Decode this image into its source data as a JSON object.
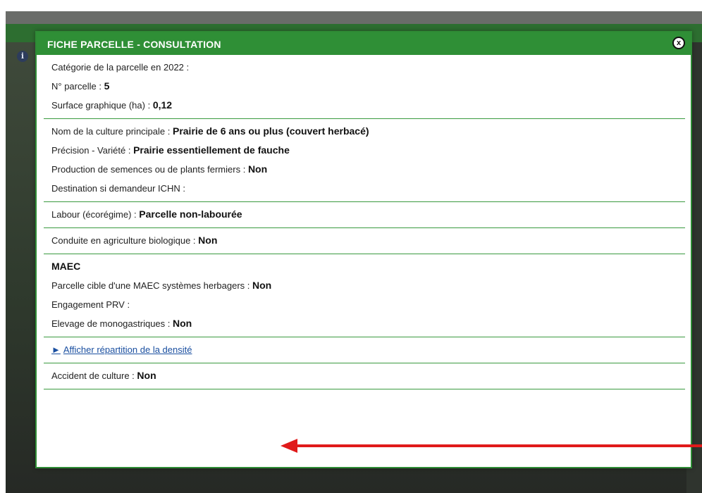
{
  "modal": {
    "title": "FICHE PARCELLE - CONSULTATION",
    "close_label": "x"
  },
  "info_icon": "i",
  "section1": {
    "categorie_label": "Catégorie de la parcelle en 2022 :",
    "parcelle_label": "N° parcelle :",
    "parcelle_value": "5",
    "surface_label": "Surface graphique (ha) :",
    "surface_value": "0,12"
  },
  "section2": {
    "culture_label": "Nom de la culture principale :",
    "culture_value": "Prairie de 6 ans ou plus (couvert herbacé)",
    "precision_label": "Précision - Variété :",
    "precision_value": "Prairie essentiellement de fauche",
    "semences_label": "Production de semences ou de plants fermiers :",
    "semences_value": "Non",
    "destination_label": "Destination si demandeur ICHN :"
  },
  "section3": {
    "labour_label": "Labour (écorégime) :",
    "labour_value": "Parcelle non-labourée"
  },
  "section4": {
    "bio_label": "Conduite en agriculture biologique :",
    "bio_value": "Non"
  },
  "section5": {
    "heading": "MAEC",
    "cible_label": "Parcelle cible d'une MAEC systèmes herbagers :",
    "cible_value": "Non",
    "prv_label": "Engagement PRV :",
    "mono_label": "Elevage de monogastriques :",
    "mono_value": "Non"
  },
  "section6": {
    "link_arrow": "►",
    "link_label": "Afficher répartition de la densité"
  },
  "section7": {
    "accident_label": "Accident de culture :",
    "accident_value": "Non"
  },
  "colors": {
    "header_green": "#2f8f36",
    "divider_green": "#3a9a3f",
    "annotation_red": "#e01a1a",
    "link_blue": "#1a4fa0"
  }
}
